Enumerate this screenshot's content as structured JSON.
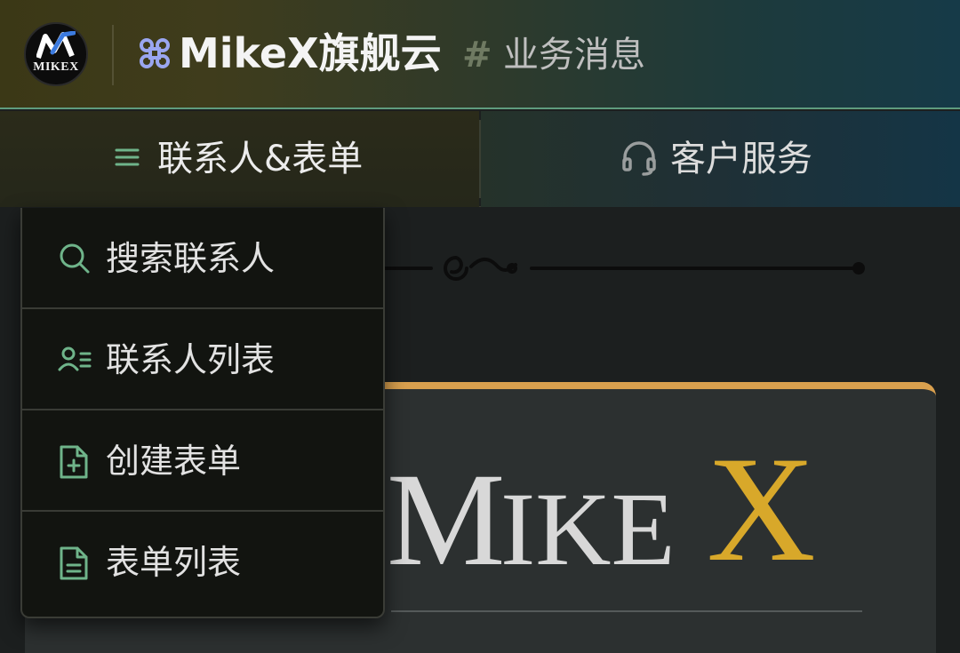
{
  "header": {
    "logo_text": "MIKEX",
    "brand_title": "MikeX旗舰云",
    "section_hash": "#",
    "section_title": "业务消息"
  },
  "tabs": [
    {
      "label": "联系人&表单",
      "icon": "menu-icon",
      "active": true
    },
    {
      "label": "客户服务",
      "icon": "headset-icon",
      "active": false
    }
  ],
  "dropdown": {
    "items": [
      {
        "label": "搜索联系人",
        "icon": "search-icon"
      },
      {
        "label": "联系人列表",
        "icon": "contact-list-icon"
      },
      {
        "label": "创建表单",
        "icon": "file-add-icon"
      },
      {
        "label": "表单列表",
        "icon": "file-text-icon"
      }
    ]
  },
  "colors": {
    "accent_green": "#6fb48a",
    "card_top_border": "#d9a04e",
    "gold": "#d8a82a"
  }
}
